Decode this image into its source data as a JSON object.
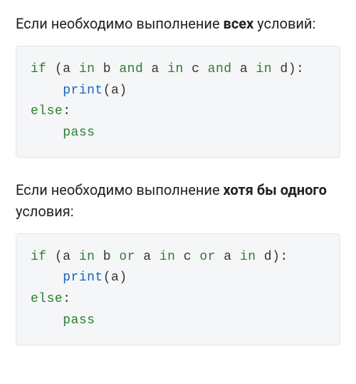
{
  "section1": {
    "text_pre": "Если необходимо выполнение ",
    "text_bold": "всех",
    "text_post": " условий:"
  },
  "code1": {
    "tokens": [
      {
        "t": "if",
        "c": "kw"
      },
      {
        "t": " (a "
      },
      {
        "t": "in",
        "c": "kw"
      },
      {
        "t": " b "
      },
      {
        "t": "and",
        "c": "kw"
      },
      {
        "t": " a "
      },
      {
        "t": "in",
        "c": "kw"
      },
      {
        "t": " c "
      },
      {
        "t": "and",
        "c": "kw"
      },
      {
        "t": " a "
      },
      {
        "t": "in",
        "c": "kw"
      },
      {
        "t": " d):\n"
      },
      {
        "t": "    "
      },
      {
        "t": "print",
        "c": "fn"
      },
      {
        "t": "(a)\n"
      },
      {
        "t": "else",
        "c": "kw"
      },
      {
        "t": ":\n"
      },
      {
        "t": "    "
      },
      {
        "t": "pass",
        "c": "kw"
      }
    ]
  },
  "section2": {
    "text_pre": "Если необходимо выполнение ",
    "text_bold": "хотя бы одного",
    "text_post": " условия:"
  },
  "code2": {
    "tokens": [
      {
        "t": "if",
        "c": "kw"
      },
      {
        "t": " (a "
      },
      {
        "t": "in",
        "c": "kw"
      },
      {
        "t": " b "
      },
      {
        "t": "or",
        "c": "kw"
      },
      {
        "t": " a "
      },
      {
        "t": "in",
        "c": "kw"
      },
      {
        "t": " c "
      },
      {
        "t": "or",
        "c": "kw"
      },
      {
        "t": " a "
      },
      {
        "t": "in",
        "c": "kw"
      },
      {
        "t": " d):\n"
      },
      {
        "t": "    "
      },
      {
        "t": "print",
        "c": "fn"
      },
      {
        "t": "(a)\n"
      },
      {
        "t": "else",
        "c": "kw"
      },
      {
        "t": ":\n"
      },
      {
        "t": "    "
      },
      {
        "t": "pass",
        "c": "kw"
      }
    ]
  }
}
